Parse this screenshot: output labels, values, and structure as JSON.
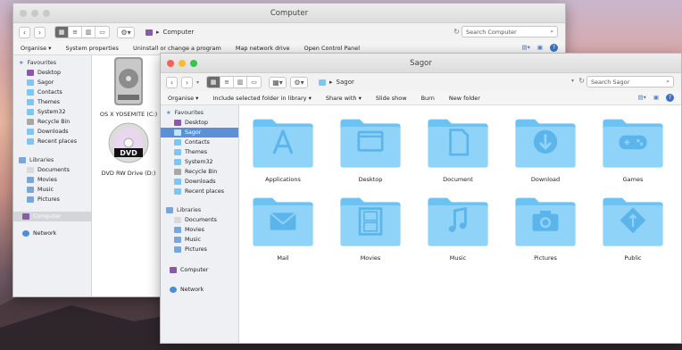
{
  "colors": {
    "folder_light": "#8fd3f8",
    "folder_dark": "#6cc2f2",
    "folder_glyph": "#5bb5ea",
    "selection": "#5b8fd6"
  },
  "back_window": {
    "title": "Computer",
    "path": "Computer",
    "search_placeholder": "Search Computer",
    "commands": [
      "Organise",
      "System properties",
      "Uninstall or change a program",
      "Map network drive",
      "Open Control Panel"
    ],
    "sidebar": {
      "favourites_header": "Favourites",
      "favourites": [
        "Desktop",
        "Sagor",
        "Contacts",
        "Themes",
        "System32",
        "Recycle Bin",
        "Downloads",
        "Recent places"
      ],
      "libraries_header": "Libraries",
      "libraries": [
        "Documents",
        "Movies",
        "Music",
        "Pictures"
      ],
      "computer": "Computer",
      "network": "Network"
    },
    "drives": [
      {
        "label": "OS X YOSEMITE (C:)",
        "icon": "hard-drive-icon"
      },
      {
        "label": "DVD RW Drive (D:)",
        "icon": "dvd-drive-icon"
      }
    ]
  },
  "front_window": {
    "title": "Sagor",
    "path": "Sagor",
    "search_placeholder": "Search Sagor",
    "commands": [
      "Organise",
      "Include selected folder in library",
      "Share with",
      "Slide show",
      "Burn",
      "New folder"
    ],
    "sidebar": {
      "favourites_header": "Favourites",
      "favourites": [
        "Desktop",
        "Sagor",
        "Contacts",
        "Themes",
        "System32",
        "Recycle Bin",
        "Downloads",
        "Recent places"
      ],
      "libraries_header": "Libraries",
      "libraries": [
        "Documents",
        "Movies",
        "Music",
        "Pictures"
      ],
      "computer": "Computer",
      "network": "Network"
    },
    "folders": [
      {
        "label": "Applications",
        "icon": "applications-icon"
      },
      {
        "label": "Desktop",
        "icon": "desktop-icon"
      },
      {
        "label": "Document",
        "icon": "document-icon"
      },
      {
        "label": "Download",
        "icon": "download-icon"
      },
      {
        "label": "Games",
        "icon": "gamepad-icon"
      },
      {
        "label": "Mail",
        "icon": "mail-icon"
      },
      {
        "label": "Movies",
        "icon": "film-icon"
      },
      {
        "label": "Music",
        "icon": "music-note-icon"
      },
      {
        "label": "Pictures",
        "icon": "camera-icon"
      },
      {
        "label": "Public",
        "icon": "public-sign-icon"
      }
    ]
  }
}
